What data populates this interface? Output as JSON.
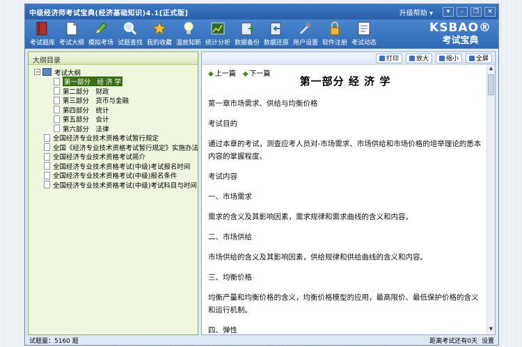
{
  "window": {
    "title": "中级经济师考试宝典(经济基础知识)4.1[正式版]",
    "help": "升级帮助 ▾",
    "controls": [
      "▾",
      "–",
      "❐",
      "✕"
    ]
  },
  "toolbar": {
    "items": [
      {
        "label": "考试题库",
        "icon": "book-icon"
      },
      {
        "label": "考试大纲",
        "icon": "document-icon"
      },
      {
        "label": "模拟考场",
        "icon": "pencil-icon"
      },
      {
        "label": "试题查找",
        "icon": "search-icon"
      },
      {
        "label": "我的收藏",
        "icon": "star-icon"
      },
      {
        "label": "温故知新",
        "icon": "lightbulb-icon"
      },
      {
        "label": "统计分析",
        "icon": "chart-icon"
      },
      {
        "label": "数据备份",
        "icon": "backup-icon"
      },
      {
        "label": "数据还原",
        "icon": "restore-icon"
      },
      {
        "label": "用户设置",
        "icon": "tools-icon"
      },
      {
        "label": "软件注册",
        "icon": "lock-icon"
      },
      {
        "label": "考试动态",
        "icon": "news-icon"
      }
    ],
    "logo_top": "KSBAO®",
    "logo_bottom": "考试宝典"
  },
  "left_pane": {
    "header": "大纲目录",
    "root": "考试大纲",
    "parts": [
      "第一部分　经 济 学",
      "第二部分　财政",
      "第三部分　货币与金融",
      "第四部分　统计",
      "第五部分　会计",
      "第六部分　法律"
    ],
    "docs": [
      "全国经济专业技术资格考试暂行规定",
      "全国《经济专业技术资格考试暂行规定》实施办法",
      "全国经济专业技术资格考试简介",
      "全国经济专业技术资格考试(中级)考试报名时间",
      "全国经济专业技术资格考试(中级)报名条件",
      "全国经济专业技术资格考试(中级)考试科目与时间"
    ]
  },
  "right_pane": {
    "buttons": {
      "print": "打印",
      "zoom_in": "放大",
      "zoom_out": "缩小",
      "fullscreen": "全屏"
    },
    "prev": "上一篇",
    "next": "下一篇",
    "title": "第一部分 经 济 学",
    "paragraphs": [
      "第一章市场需求、供给与均衡价格",
      "考试目的",
      "通过本章的考试，测查应考人员对-市场需求、市场供给和市场价格的培举理论的悉本内容的掌握程度。",
      "考试内容",
      "一、市场需求",
      "需求的含义及其影响因素，需求规律和需求曲线的含义和内容。",
      "二、市场供给",
      "市场供给的含义及其影响因素，供给规律和供给曲线的含义和内容。",
      "三、均衡价格",
      "均衡产量和均衡价格的含义，均衡价格模型的应用，最高限价、最低保护价格的含义和运行机制。",
      "四、弹性"
    ]
  },
  "status": {
    "count": "试题量：5160 题",
    "countdown": "距离考试还有0天",
    "settings": "设置"
  }
}
